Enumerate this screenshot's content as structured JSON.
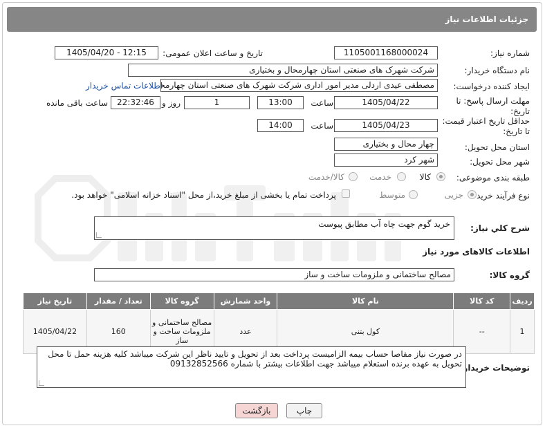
{
  "header": {
    "title": "جزئیات اطلاعات نیاز"
  },
  "labels": {
    "need_number": "شماره نیاز:",
    "announce_datetime": "تاریخ و ساعت اعلان عمومی:",
    "buyer_org": "نام دستگاه خریدار:",
    "requester": "ایجاد کننده درخواست:",
    "deadline": "مهلت ارسال پاسخ: تا تاریخ:",
    "price_validity": "حداقل تاریخ اعتبار قیمت: تا تاریخ:",
    "time": "ساعت",
    "day": "روز و",
    "remaining": "ساعت باقی مانده",
    "province": "استان محل تحویل:",
    "city": "شهر محل تحویل:",
    "category": "طبقه بندی موضوعی:",
    "process": "نوع فرآیند خرید :",
    "need_desc": "شرح کلي نياز:",
    "goods_info": "اطلاعات کالاهای مورد نیاز",
    "goods_group": "گروه کالا:",
    "buyer_notes": "توضیحات خریدار:"
  },
  "fields": {
    "need_number": "1105001168000024",
    "announce_datetime": "1405/04/20 - 12:15",
    "buyer_org": "شرکت شهرک های صنعتی استان چهارمحال و بختیاری",
    "requester": "مصطفی عیدی اردلی مدیر امور اداری شرکت شهرک های صنعتی استان چهارمحال و بختیاری",
    "contact_link": "اطلاعات تماس خریدار",
    "deadline_date": "1405/04/22",
    "deadline_time": "13:00",
    "days": "1",
    "remaining_time": "22:32:46",
    "validity_date": "1405/04/23",
    "validity_time": "14:00",
    "province": "چهار محال و بختیاری",
    "city": "شهر کرد",
    "need_desc": "خرید گوم  جهت چاه آب مطابق پیوست",
    "goods_group": "مصالح ساختمانی و ملزومات ساخت و ساز",
    "buyer_notes": "در صورت نیاز مفاصا حساب بیمه الزامیست پرداخت بعد از تحویل و تایید ناظر این شرکت میباشد کلیه هزینه حمل تا محل تحویل به عهده برنده استعلام میباشد جهت اطلاعات بیشتر با شماره 09132852566"
  },
  "category_options": {
    "goods": "کالا",
    "service": "خدمت",
    "goods_service": "کالا/خدمت",
    "selected": "goods"
  },
  "process_options": {
    "minor": "جزیی",
    "medium": "متوسط",
    "selected": "minor",
    "treasury_note": "پرداخت تمام یا بخشی از مبلغ خرید،از محل \"اسناد خزانه اسلامی\" خواهد بود."
  },
  "table": {
    "headers": [
      "ردیف",
      "کد کالا",
      "نام کالا",
      "واحد شمارش",
      "گروه کالا",
      "تعداد / مقدار",
      "تاریخ نیاز"
    ],
    "rows": [
      [
        "1",
        "--",
        "کول بتنی",
        "عدد",
        "مصالح ساختمانی و ملزومات ساخت و ساز",
        "160",
        "1405/04/22"
      ]
    ]
  },
  "buttons": {
    "print": "چاپ",
    "back": "بازگشت"
  },
  "colors": {
    "header_bg": "#868686",
    "table_header_bg": "#7c7c7c",
    "back_button_bg": "#f6d5d5",
    "print_button_bg": "#f2f2f2",
    "link": "#1a4fa0"
  }
}
